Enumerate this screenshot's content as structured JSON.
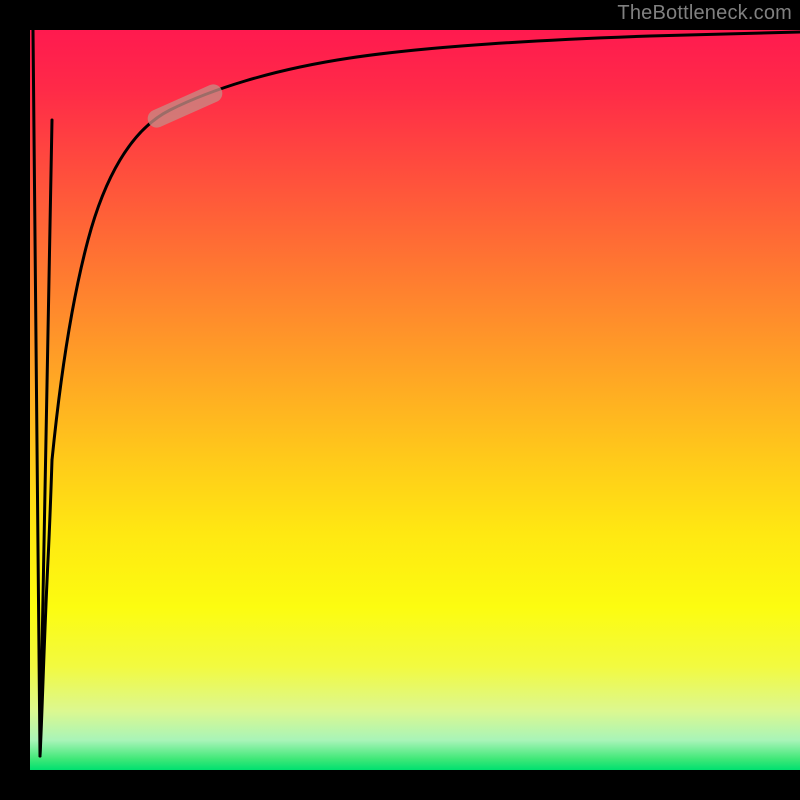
{
  "watermark": "TheBottleneck.com",
  "chart_data": {
    "type": "line",
    "title": "",
    "xlabel": "",
    "ylabel": "",
    "xlim": [
      0,
      100
    ],
    "ylim": [
      0,
      100
    ],
    "grid": false,
    "legend": false,
    "background_gradient": {
      "top_color": "#ff1a4f",
      "bottom_color": "#00e070",
      "description": "vertical red-to-green gradient"
    },
    "series": [
      {
        "name": "spike-down",
        "description": "sharp vertical spike from top to near-bottom at very left edge",
        "x": [
          0.0,
          1.5,
          3.0
        ],
        "y": [
          100,
          2,
          96
        ]
      },
      {
        "name": "main-curve",
        "description": "logarithmic-like rise from lower-left toward top-right asymptote",
        "x": [
          3.0,
          4,
          5,
          6,
          8,
          10,
          12,
          15,
          18,
          22,
          26,
          30,
          35,
          40,
          50,
          60,
          70,
          80,
          90,
          100
        ],
        "y": [
          40,
          55,
          63,
          68,
          74,
          78,
          81,
          84,
          86,
          88,
          89.5,
          90.5,
          91.5,
          92.3,
          93.5,
          94.3,
          94.9,
          95.4,
          95.8,
          96.1
        ]
      }
    ],
    "annotations": [
      {
        "name": "highlight-pill",
        "description": "rounded faded capsule segment along curve",
        "x_center": 20,
        "y_center": 86.5,
        "angle_deg": 24,
        "color": "#c88a84"
      }
    ]
  }
}
